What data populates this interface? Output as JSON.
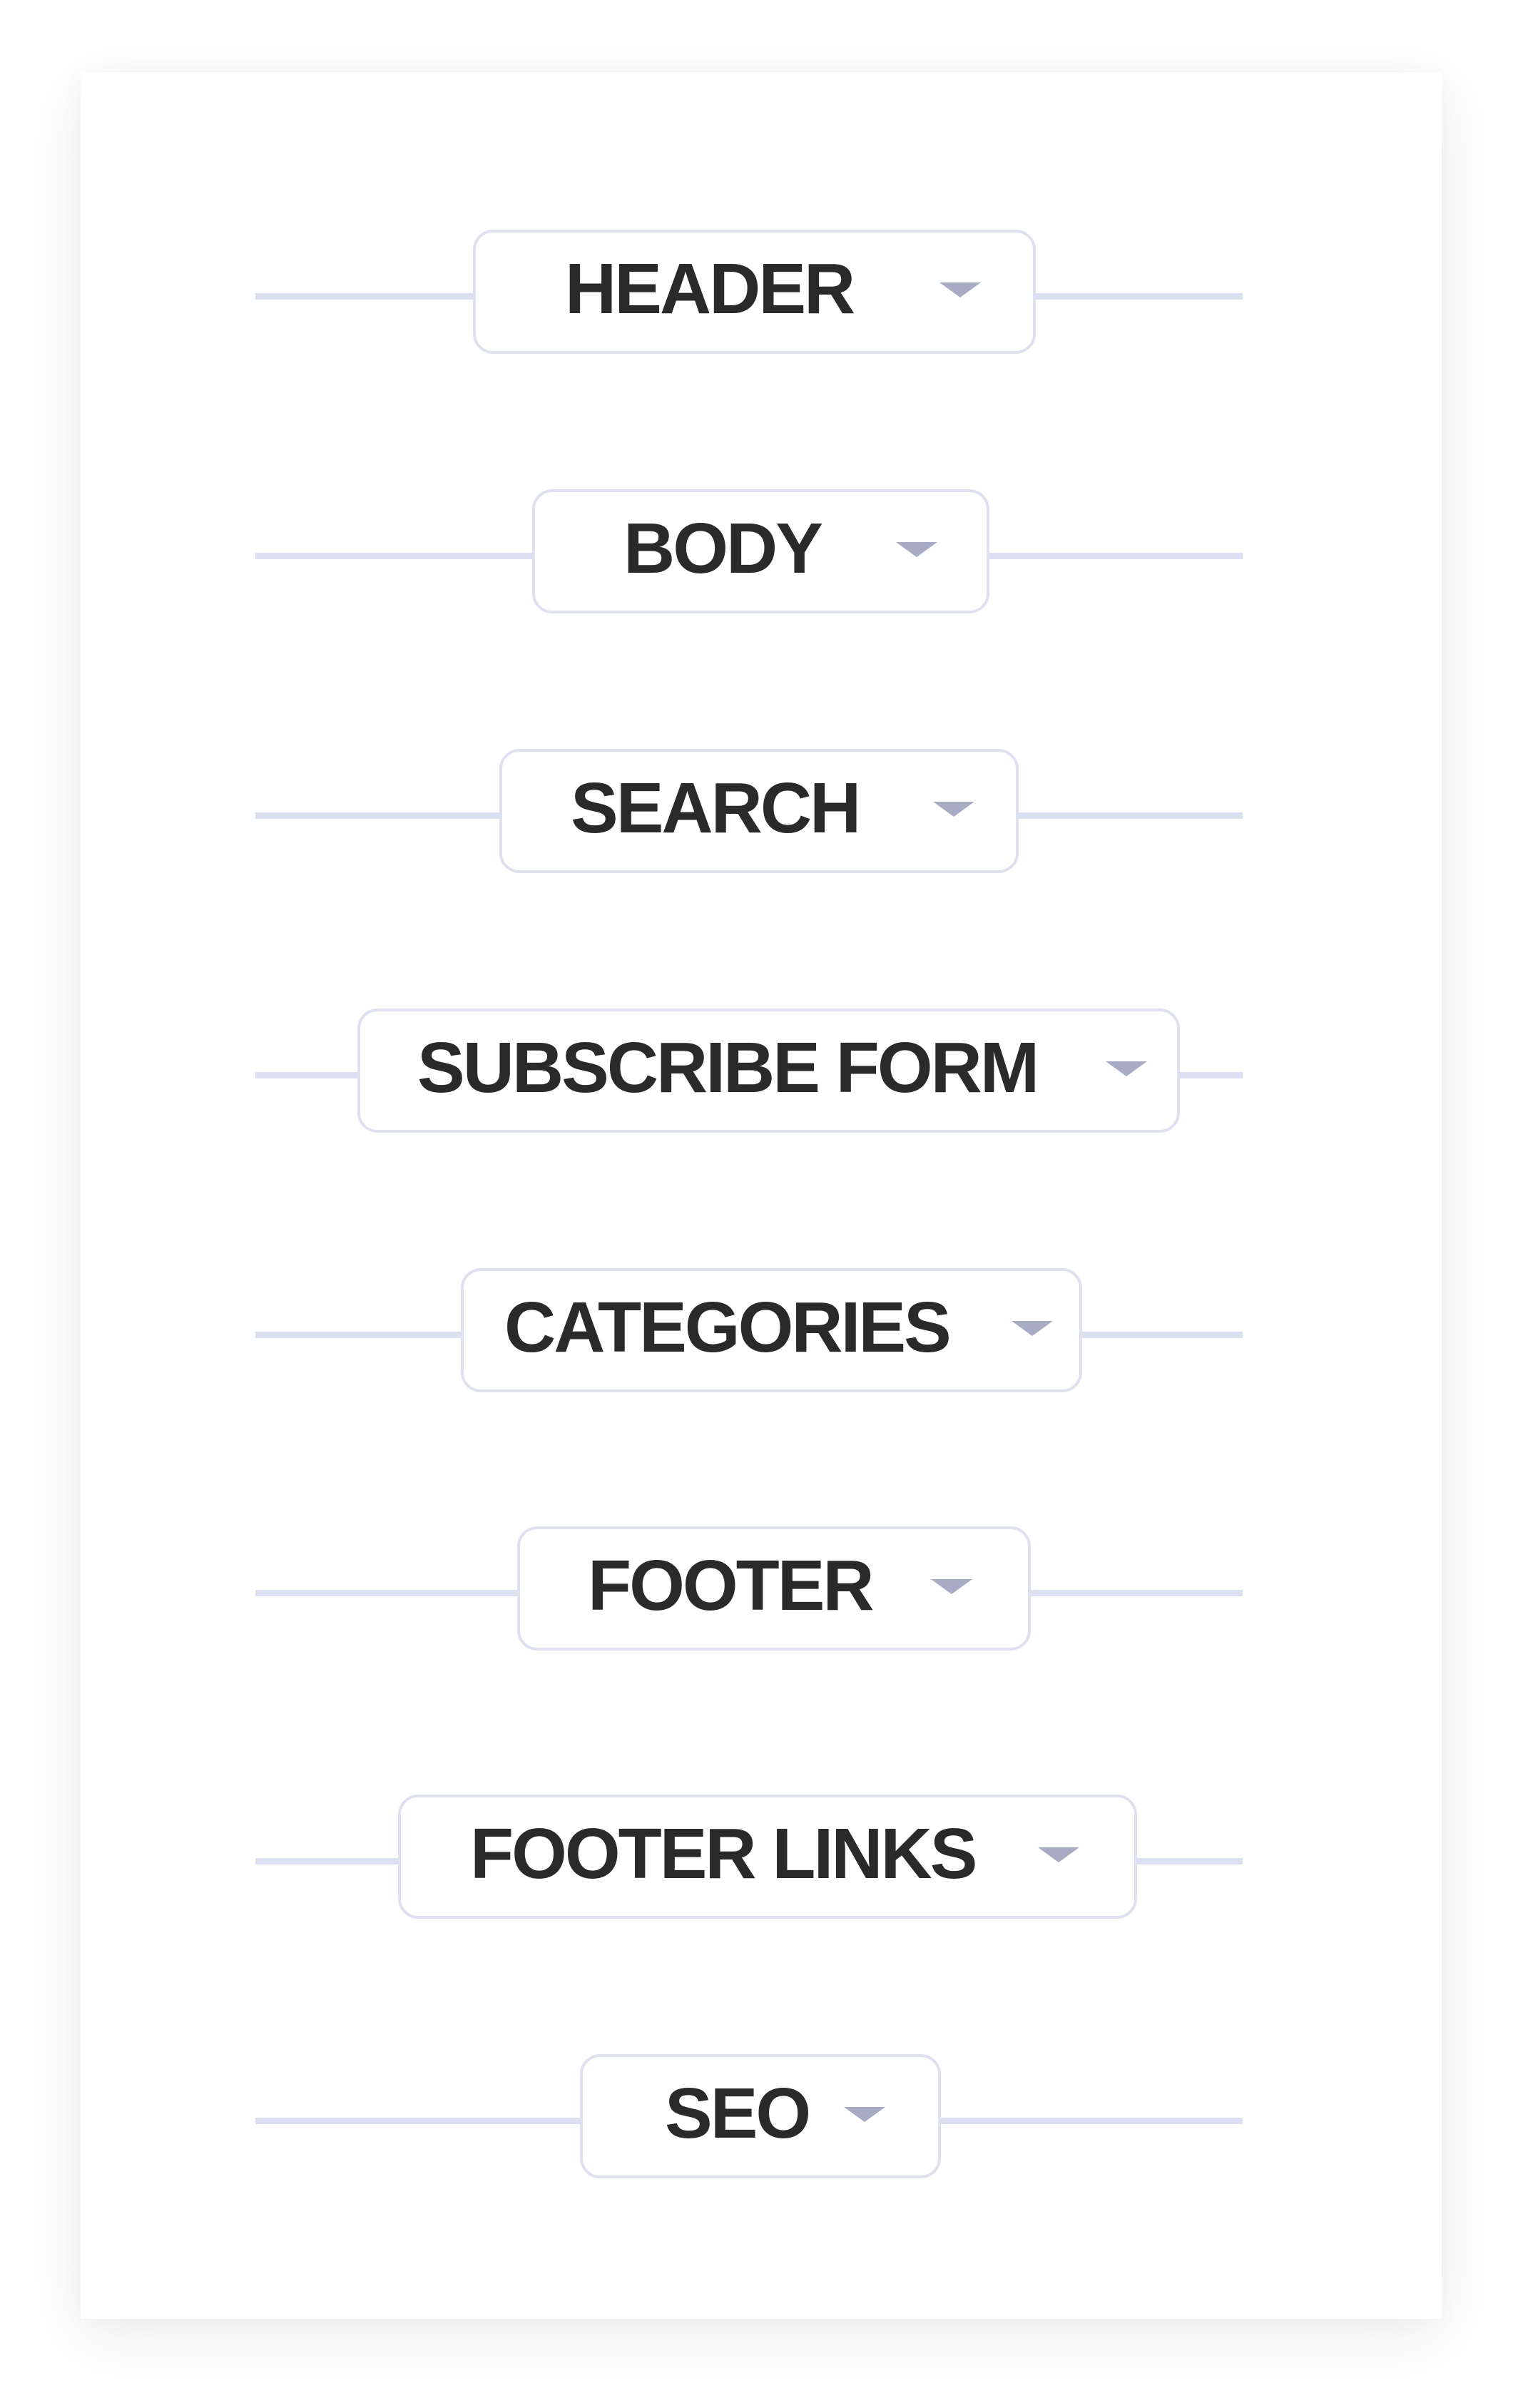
{
  "colors": {
    "connector_line": "#dcdff0",
    "box_border": "#dfe1f1",
    "label_text": "#2a2a2a",
    "caret": "#a7abc3",
    "card_background": "#ffffff"
  },
  "sections": [
    {
      "label": "HEADER",
      "icon": "caret-down-icon"
    },
    {
      "label": "BODY",
      "icon": "caret-down-icon"
    },
    {
      "label": "SEARCH",
      "icon": "caret-down-icon"
    },
    {
      "label": "SUBSCRIBE FORM",
      "icon": "caret-down-icon"
    },
    {
      "label": "CATEGORIES",
      "icon": "caret-down-icon"
    },
    {
      "label": "FOOTER",
      "icon": "caret-down-icon"
    },
    {
      "label": "FOOTER LINKS",
      "icon": "caret-down-icon"
    },
    {
      "label": "SEO",
      "icon": "caret-down-icon"
    }
  ]
}
